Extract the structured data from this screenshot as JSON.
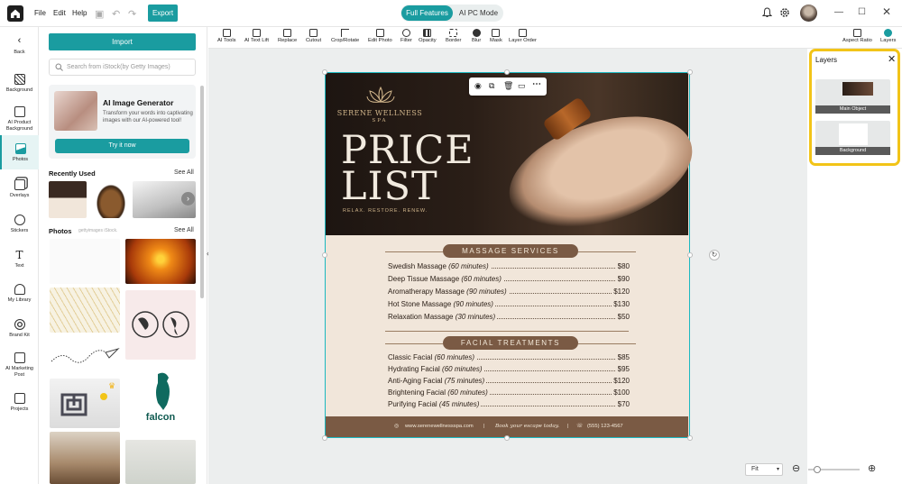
{
  "menu": {
    "file": "File",
    "edit": "Edit",
    "help": "Help",
    "export": "Export"
  },
  "modes": {
    "full": "Full Features",
    "ai_pc": "AI PC Mode"
  },
  "colors": {
    "accent": "#1a9ca0",
    "highlight": "#f2c418",
    "design_brown": "#7a5a44"
  },
  "leftbar": [
    {
      "label": "Back",
      "icon": "back-arrow-icon"
    },
    {
      "label": "Background",
      "icon": "background-icon"
    },
    {
      "label": "AI Product Background",
      "icon": "ai-product-icon"
    },
    {
      "label": "Photos",
      "icon": "photos-icon"
    },
    {
      "label": "Overlays",
      "icon": "overlays-icon"
    },
    {
      "label": "Stickers",
      "icon": "stickers-icon"
    },
    {
      "label": "Text",
      "icon": "text-icon"
    },
    {
      "label": "My Library",
      "icon": "library-icon"
    },
    {
      "label": "Brand Kit",
      "icon": "brand-kit-icon"
    },
    {
      "label": "AI Marketing Post",
      "icon": "ai-marketing-icon"
    },
    {
      "label": "Projects",
      "icon": "projects-icon"
    }
  ],
  "panel": {
    "import": "Import",
    "search_placeholder": "Search from iStock(by Getty Images)",
    "ai_title": "AI Image Generator",
    "ai_desc": "Transform your words into captivating images with our AI-powered tool!",
    "ai_button": "Try it now",
    "recent": "Recently Used",
    "see_all": "See All",
    "photos": "Photos",
    "photos_sources": "gettyimages  iStock.",
    "falcon": "falcon"
  },
  "toolbar": [
    "AI Tools",
    "AI Text Lift",
    "Replace",
    "Cutout",
    "Crop/Rotate",
    "Edit Photo",
    "Filter",
    "Opacity",
    "Border",
    "Blur",
    "Mask",
    "Layer Order"
  ],
  "toolbar_right": [
    "Aspect Ratio",
    "Layers"
  ],
  "layers": {
    "title": "Layers",
    "items": [
      "Main Object",
      "Background"
    ]
  },
  "design": {
    "brand_line1": "SERENE WELLNESS",
    "brand_line2": "SPA",
    "title_1": "PRICE",
    "title_2": "LIST",
    "tagline": "RELAX. RESTORE. RENEW.",
    "section1": "MASSAGE SERVICES",
    "massage": [
      {
        "name": "Swedish Massage",
        "dur": "(60 minutes)",
        "price": "$80"
      },
      {
        "name": "Deep Tissue Massage",
        "dur": "(60 minutes)",
        "price": "$90"
      },
      {
        "name": "Aromatherapy Massage",
        "dur": "(90 minutes)",
        "price": "$120"
      },
      {
        "name": "Hot Stone Massage",
        "dur": "(90 minutes)",
        "price": "$130"
      },
      {
        "name": "Relaxation Massage",
        "dur": "(30 minutes)",
        "price": "$50"
      }
    ],
    "section2": "FACIAL TREATMENTS",
    "facial": [
      {
        "name": "Classic Facial",
        "dur": "(60 minutes)",
        "price": "$85"
      },
      {
        "name": "Hydrating Facial",
        "dur": "(60 minutes)",
        "price": "$95"
      },
      {
        "name": "Anti-Aging Facial",
        "dur": "(75 minutes)",
        "price": "$120"
      },
      {
        "name": "Brightening Facial",
        "dur": "(60 minutes)",
        "price": "$100"
      },
      {
        "name": "Purifying Facial",
        "dur": "(45 minutes)",
        "price": "$70"
      }
    ],
    "footer_web": "www.serenewellnessspa.com",
    "footer_book": "Book your escape today.",
    "footer_phone": "(555) 123-4567"
  },
  "zoom": {
    "fit": "Fit"
  }
}
